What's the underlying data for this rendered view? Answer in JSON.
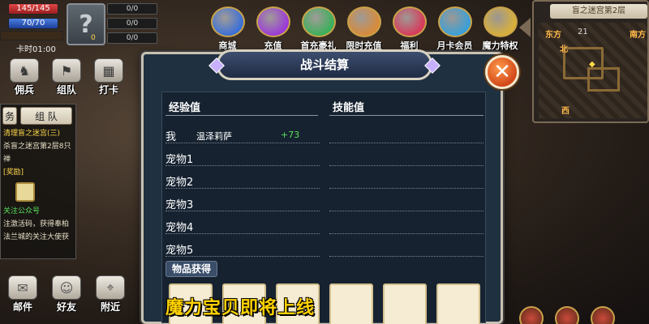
{
  "player": {
    "hp": "145/145",
    "mp": "70/70",
    "pet_level": "0",
    "pet_stat1": "0/0",
    "pet_stat2": "0/0",
    "pet_stat3": "0/0",
    "card_time": "卡时01:00"
  },
  "top_menu": [
    {
      "label": "商城",
      "icon": "shop-icon",
      "color": "#3a6fd8"
    },
    {
      "label": "充值",
      "icon": "recharge-icon",
      "color": "#9a3ad8"
    },
    {
      "label": "首充豪礼",
      "icon": "first-recharge-icon",
      "color": "#3ab05a"
    },
    {
      "label": "限时充值",
      "icon": "limited-recharge-icon",
      "color": "#d88a3a"
    },
    {
      "label": "福利",
      "icon": "gift-icon",
      "color": "#d83a5a"
    },
    {
      "label": "月卡会员",
      "icon": "month-card-icon",
      "color": "#3aa0d8"
    },
    {
      "label": "魔力特权",
      "icon": "privilege-icon",
      "color": "#d8b03a"
    }
  ],
  "minimap": {
    "title": "盲之迷宫第2层",
    "east_label": "东方",
    "coord_x": "21",
    "north": "北",
    "south_label": "南方",
    "west": "西"
  },
  "side_buttons": [
    {
      "label": "佣兵",
      "icon": "mercenary-icon"
    },
    {
      "label": "组队",
      "icon": "team-icon"
    },
    {
      "label": "打卡",
      "icon": "checkin-icon"
    }
  ],
  "quest": {
    "tab_task": "务",
    "tab_team": "组 队",
    "line1": "清理盲之迷宫(三)",
    "line2": "杀盲之迷宫第2层8只",
    "line3": "禅",
    "line4": "[奖励]",
    "line5": "关注公众号",
    "line6": "注激活码，获得奉柏",
    "line7": "法兰城的关注大使获"
  },
  "bottom_buttons": [
    {
      "label": "邮件",
      "icon": "mail-icon"
    },
    {
      "label": "好友",
      "icon": "friends-icon"
    },
    {
      "label": "附近",
      "icon": "nearby-icon"
    }
  ],
  "dialog": {
    "title": "战斗结算",
    "exp_header": "经验值",
    "skill_header": "技能值",
    "rows": [
      {
        "label": "我",
        "name": "温泽莉萨",
        "exp": "+73"
      },
      {
        "label": "宠物1",
        "name": "",
        "exp": ""
      },
      {
        "label": "宠物2",
        "name": "",
        "exp": ""
      },
      {
        "label": "宠物3",
        "name": "",
        "exp": ""
      },
      {
        "label": "宠物4",
        "name": "",
        "exp": ""
      },
      {
        "label": "宠物5",
        "name": "",
        "exp": ""
      }
    ],
    "items_header": "物品获得",
    "close_symbol": "✕"
  },
  "caption": "魔力宝贝即将上线",
  "colors": {
    "dialog_bg": "#1f3040",
    "exp_green": "#5ae05a",
    "caption_yellow": "#ffd200",
    "close_orange": "#d2481a"
  }
}
